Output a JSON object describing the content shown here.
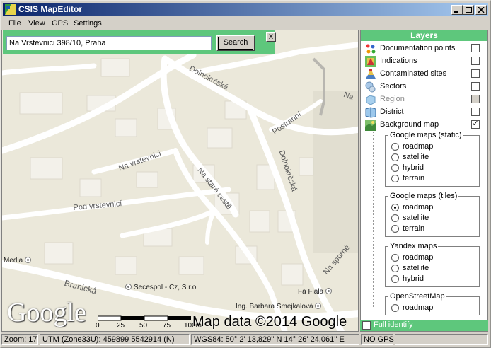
{
  "window": {
    "title": "CSIS MapEditor"
  },
  "menu": {
    "file": "File",
    "view": "View",
    "gps": "GPS",
    "settings": "Settings"
  },
  "search": {
    "value": "Na Vrstevnici 398/10, Praha",
    "button": "Search",
    "close": "x"
  },
  "map": {
    "streets": [
      "Dolnokrčská",
      "Na vrstevnici",
      "Pod vrstevnicí",
      "Na staré cestě",
      "Dolnokrčská",
      "Postranní",
      "Branická",
      "Na Hr",
      "Na sporné",
      "Na"
    ],
    "pois": [
      "Media",
      "Secespol - Cz, S.r.o",
      "Fa Fiala",
      "Ing. Barbara Smejkalová"
    ],
    "logo": "Google",
    "attribution": "Map data ©2014 Google",
    "scale_ticks": [
      "0",
      "25",
      "50",
      "75",
      "100m"
    ]
  },
  "layers": {
    "title": "Layers",
    "items": [
      {
        "name": "Documentation points",
        "checked": false,
        "icon": "documentation-points-icon"
      },
      {
        "name": "Indications",
        "checked": false,
        "icon": "indications-icon"
      },
      {
        "name": "Contaminated sites",
        "checked": false,
        "icon": "contaminated-sites-icon"
      },
      {
        "name": "Sectors",
        "checked": false,
        "icon": "sectors-icon"
      },
      {
        "name": "Region",
        "checked": false,
        "disabled": true,
        "icon": "region-icon"
      },
      {
        "name": "District",
        "checked": false,
        "icon": "district-icon"
      },
      {
        "name": "Background map",
        "checked": true,
        "icon": "background-map-icon"
      }
    ],
    "groups": [
      {
        "title": "Google maps (static)",
        "options": [
          "roadmap",
          "satellite",
          "hybrid",
          "terrain"
        ]
      },
      {
        "title": "Google maps (tiles)",
        "options": [
          "roadmap",
          "satellite",
          "terrain"
        ],
        "selected": "roadmap"
      },
      {
        "title": "Yandex maps",
        "options": [
          "roadmap",
          "satellite",
          "hybrid"
        ]
      },
      {
        "title": "OpenStreetMap",
        "options": [
          "roadmap"
        ]
      }
    ],
    "full_identify": "Full identify"
  },
  "status": {
    "zoom": "Zoom: 17",
    "utm": "UTM (Zone33U):  459899  5542914 (N)",
    "wgs": "WGS84:  50° 2' 13,829'' N     14° 26' 24,061'' E",
    "gps": "NO GPS"
  },
  "colors": {
    "panel_accent": "#5ec77c",
    "title_start": "#0a246a",
    "title_end": "#a6caf0"
  }
}
